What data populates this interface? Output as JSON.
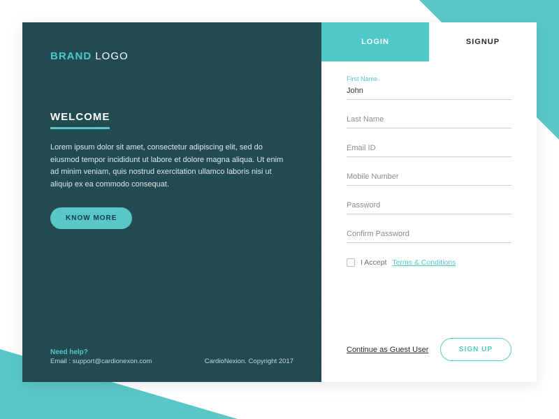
{
  "colors": {
    "accent": "#5ac7c7",
    "panel": "#214a51"
  },
  "brand": {
    "part1": "BRAND",
    "part2": "LOGO"
  },
  "left": {
    "welcome": "WELCOME",
    "description": "Lorem ipsum dolor sit amet, consectetur adipiscing elit, sed do eiusmod tempor incididunt ut labore et dolore magna aliqua. Ut enim ad minim veniam, quis nostrud exercitation ullamco laboris nisi ut aliquip ex ea commodo consequat.",
    "know_more": "KNOW MORE",
    "help_label": "Need help?",
    "help_email": "Email : support@cardionexon.com",
    "copyright": "CardioNexion. Copyright 2017"
  },
  "tabs": {
    "login": "LOGIN",
    "signup": "SIGNUP"
  },
  "form": {
    "first_name": {
      "label": "First Name",
      "value": "John"
    },
    "last_name": {
      "placeholder": "Last Name",
      "value": ""
    },
    "email": {
      "placeholder": "Email ID",
      "value": ""
    },
    "mobile": {
      "placeholder": "Mobile Number",
      "value": ""
    },
    "password": {
      "placeholder": "Password",
      "value": ""
    },
    "confirm_password": {
      "placeholder": "Confirm Password",
      "value": ""
    },
    "terms": {
      "prefix": "I Accept ",
      "link": "Terms & Conditions",
      "checked": false
    },
    "guest_link": "Continue as Guest User",
    "signup_button": "SIGN UP"
  }
}
